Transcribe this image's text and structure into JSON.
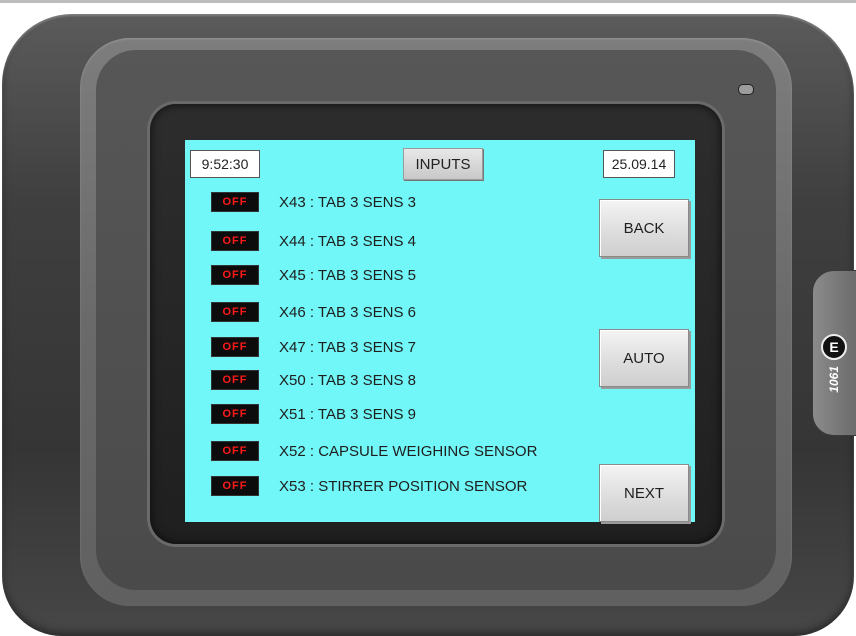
{
  "hmi": {
    "time": "9:52:30",
    "date": "25.09.14",
    "title": "INPUTS",
    "buttons": {
      "back": "BACK",
      "auto": "AUTO",
      "next": "NEXT"
    },
    "inputs": [
      {
        "status": "OFF",
        "label": "X43 : TAB 3 SENS 3"
      },
      {
        "status": "OFF",
        "label": "X44 : TAB 3 SENS 4"
      },
      {
        "status": "OFF",
        "label": "X45 : TAB 3 SENS 5"
      },
      {
        "status": "OFF",
        "label": "X46 : TAB 3 SENS 6"
      },
      {
        "status": "OFF",
        "label": "X47 : TAB 3 SENS 7"
      },
      {
        "status": "OFF",
        "label": "X50 : TAB 3 SENS 8"
      },
      {
        "status": "OFF",
        "label": "X51 : TAB 3 SENS 9"
      },
      {
        "status": "OFF",
        "label": "X52 : CAPSULE WEIGHING SENSOR"
      },
      {
        "status": "OFF",
        "label": "X53 : STIRRER POSITION SENSOR"
      }
    ]
  },
  "device": {
    "brand_logo": "E",
    "model": "1061"
  },
  "colors": {
    "screen_bg": "#71f7f7",
    "off_text": "#ff1a1a",
    "bezel": "#3f3f3f"
  }
}
